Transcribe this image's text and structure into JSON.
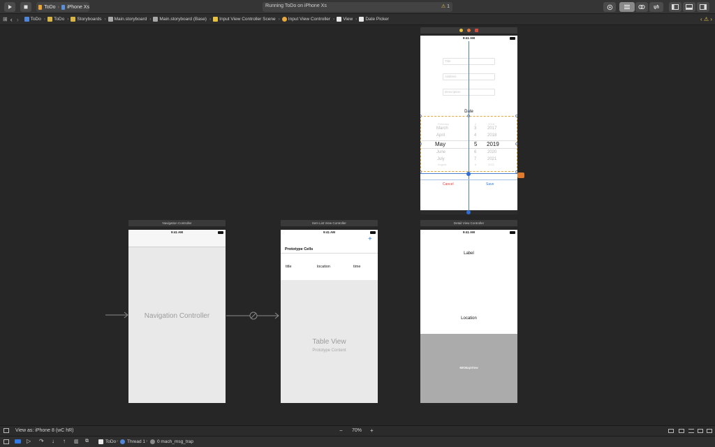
{
  "toolbar": {
    "scheme_name": "ToDo",
    "device_name": "iPhone Xs",
    "status_text": "Running ToDo on iPhone Xs",
    "warning_count": "1"
  },
  "jumpbar": {
    "items": [
      "ToDo",
      "ToDo",
      "Storyboards",
      "Main.storyboard",
      "Main.storyboard (Base)",
      "Input View Controller Scene",
      "Input View Controller",
      "View",
      "Date Picker"
    ]
  },
  "scenes": {
    "input": {
      "time": "9:41 AM",
      "title_placeholder": "Title",
      "address_placeholder": "Address",
      "description_placeholder": "Description",
      "date_label": "Date",
      "picker": {
        "months": [
          "February",
          "March",
          "April",
          "May",
          "June",
          "July",
          "August"
        ],
        "days": [
          "2",
          "3",
          "4",
          "5",
          "6",
          "7",
          "8"
        ],
        "years": [
          "2016",
          "2017",
          "2018",
          "2019",
          "2020",
          "2021",
          "2022"
        ]
      },
      "cancel_label": "Cancel",
      "save_label": "Save"
    },
    "nav": {
      "title": "Navigation Controller",
      "time": "9:41 AM",
      "body_label": "Navigation Controller"
    },
    "itemlist": {
      "title": "Item List View Controller",
      "time": "9:41 AM",
      "add_symbol": "+",
      "prototype_cells": "Prototype Cells",
      "cell_title": "title",
      "cell_location": "location",
      "cell_time": "time",
      "table_view": "Table View",
      "prototype_content": "Prototype Content"
    },
    "detail": {
      "title": "Detail View Controller",
      "time": "9:41 AM",
      "label": "Label",
      "location": "Location",
      "map": "MKMapView"
    }
  },
  "footer": {
    "view_as": "View as: iPhone 8 (wC hR)",
    "zoom": "70%",
    "zoom_minus": "−",
    "zoom_plus": "+"
  },
  "debug": {
    "app": "ToDo",
    "thread": "Thread 1",
    "frame": "0 mach_msg_trap"
  }
}
